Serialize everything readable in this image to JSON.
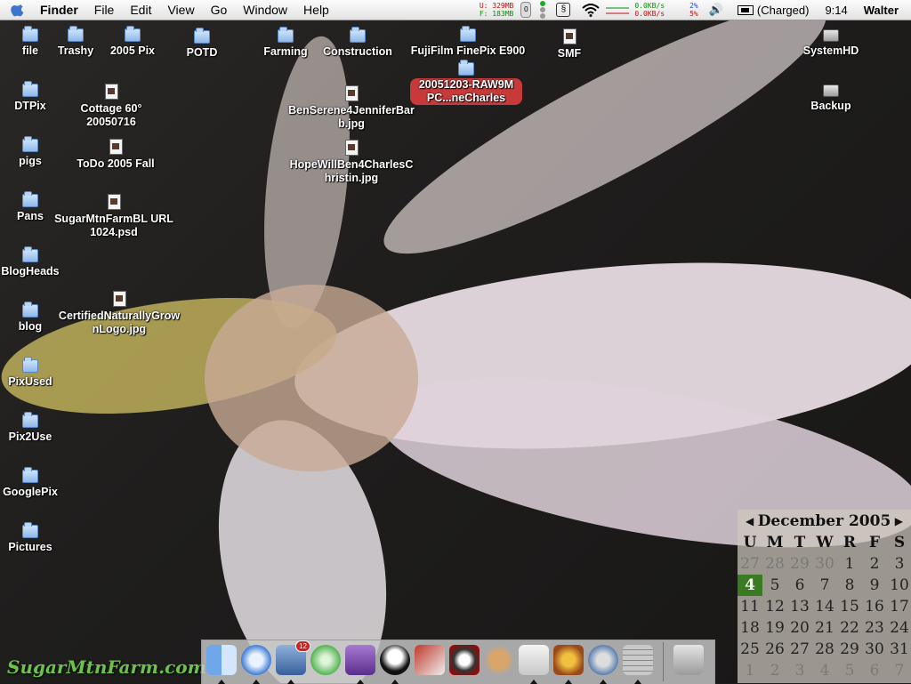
{
  "menubar": {
    "app_name": "Finder",
    "menus": [
      "File",
      "Edit",
      "View",
      "Go",
      "Window",
      "Help"
    ],
    "mem_used": "U: 329MB",
    "mem_free": "F: 183MB",
    "disk_count": "0",
    "net_in": "0.0KB/s",
    "net_out": "0.0KB/s",
    "cpu_user": "2%",
    "cpu_sys": "5%",
    "battery": "(Charged)",
    "clock": "9:14",
    "user": "Walter"
  },
  "desktop": {
    "icons": [
      {
        "label": "file",
        "type": "folder"
      },
      {
        "label": "Trashy",
        "type": "folder"
      },
      {
        "label": "2005 Pix",
        "type": "folder"
      },
      {
        "label": "POTD",
        "type": "folder"
      },
      {
        "label": "Farming",
        "type": "folder"
      },
      {
        "label": "Construction",
        "type": "folder"
      },
      {
        "label": "FujiFilm FinePix E900",
        "type": "folder"
      },
      {
        "label": "SMF",
        "type": "doc"
      },
      {
        "label": "SystemHD",
        "type": "disk"
      },
      {
        "label": "DTPix",
        "type": "folder"
      },
      {
        "label": "Cottage 60° 20050716",
        "type": "doc"
      },
      {
        "label": "20051203-RAW9MPC...neCharles",
        "type": "folder"
      },
      {
        "label": "BenSerene4JenniferBarb.jpg",
        "type": "doc"
      },
      {
        "label": "Backup",
        "type": "disk"
      },
      {
        "label": "pigs",
        "type": "folder"
      },
      {
        "label": "ToDo 2005 Fall",
        "type": "doc"
      },
      {
        "label": "HopeWillBen4CharlesChristin.jpg",
        "type": "doc"
      },
      {
        "label": "Pans",
        "type": "folder"
      },
      {
        "label": "SugarMtnFarmBL URL 1024.psd",
        "type": "doc"
      },
      {
        "label": "BlogHeads",
        "type": "folder"
      },
      {
        "label": "blog",
        "type": "folder"
      },
      {
        "label": "CertifiedNaturallyGrownLogo.jpg",
        "type": "doc"
      },
      {
        "label": "PixUsed",
        "type": "folder"
      },
      {
        "label": "Pix2Use",
        "type": "folder"
      },
      {
        "label": "GooglePix",
        "type": "folder"
      },
      {
        "label": "Pictures",
        "type": "folder"
      }
    ]
  },
  "dock": {
    "items": [
      "Finder",
      "Safari",
      "Mail",
      "iTunes",
      "iMovie",
      "Panda",
      "Preview",
      "Eye",
      "Mouse",
      "Apple",
      "Burn",
      "Compass",
      "Calculator",
      "Trash"
    ],
    "mail_badge": "12"
  },
  "watermark": "SugarMtnFarm.com",
  "calendar": {
    "month": "December 2005",
    "weekdays": [
      "U",
      "M",
      "T",
      "W",
      "R",
      "F",
      "S"
    ],
    "weeks": [
      [
        "27",
        "28",
        "29",
        "30",
        "1",
        "2",
        "3"
      ],
      [
        "4",
        "5",
        "6",
        "7",
        "8",
        "9",
        "10"
      ],
      [
        "11",
        "12",
        "13",
        "14",
        "15",
        "16",
        "17"
      ],
      [
        "18",
        "19",
        "20",
        "21",
        "22",
        "23",
        "24"
      ],
      [
        "25",
        "26",
        "27",
        "28",
        "29",
        "30",
        "31"
      ],
      [
        "1",
        "2",
        "3",
        "4",
        "5",
        "6",
        "7"
      ]
    ],
    "today": "4"
  }
}
